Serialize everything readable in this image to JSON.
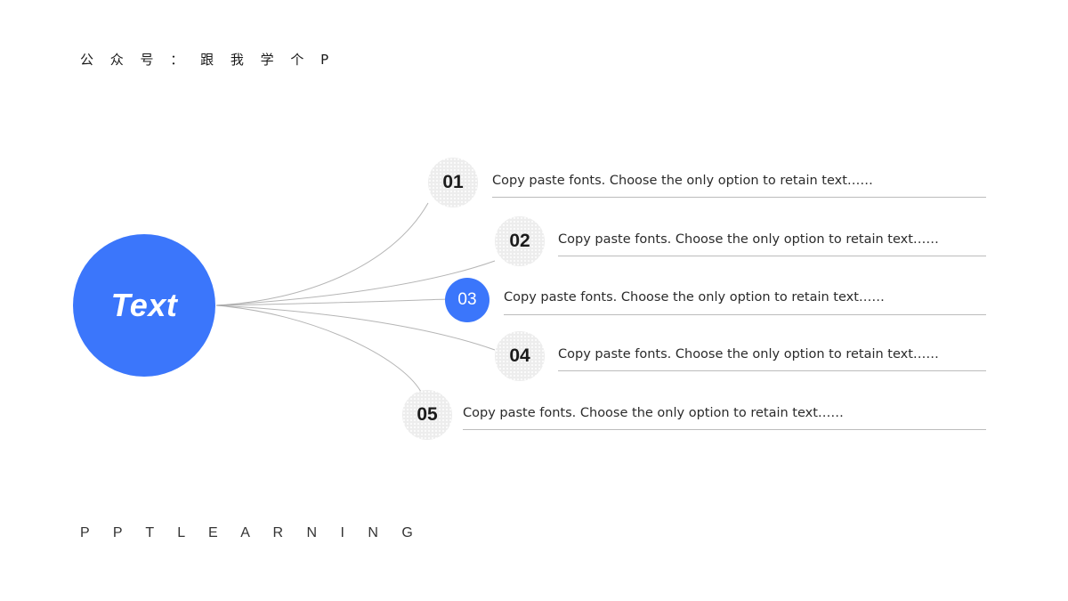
{
  "header": {
    "brand": "公 众 号 ：  跟 我 学 个 P"
  },
  "footer": {
    "brand": "P P T   L E A R N I N G"
  },
  "hub": {
    "label": "Text",
    "color": "#3b76fb"
  },
  "colors": {
    "accent": "#3b76fb",
    "bubble_bg": "#ededed",
    "rule": "#bcbcbc",
    "text": "#2b2b2b"
  },
  "items": [
    {
      "number": "01",
      "text": "Copy paste fonts. Choose the only option to retain text……",
      "active": false
    },
    {
      "number": "02",
      "text": "Copy paste fonts. Choose the only option to retain text……",
      "active": false
    },
    {
      "number": "03",
      "text": "Copy paste fonts. Choose the only option to retain text……",
      "active": true
    },
    {
      "number": "04",
      "text": "Copy paste fonts. Choose the only option to retain text……",
      "active": false
    },
    {
      "number": "05",
      "text": "Copy paste fonts. Choose the only option to retain text……",
      "active": false
    }
  ]
}
